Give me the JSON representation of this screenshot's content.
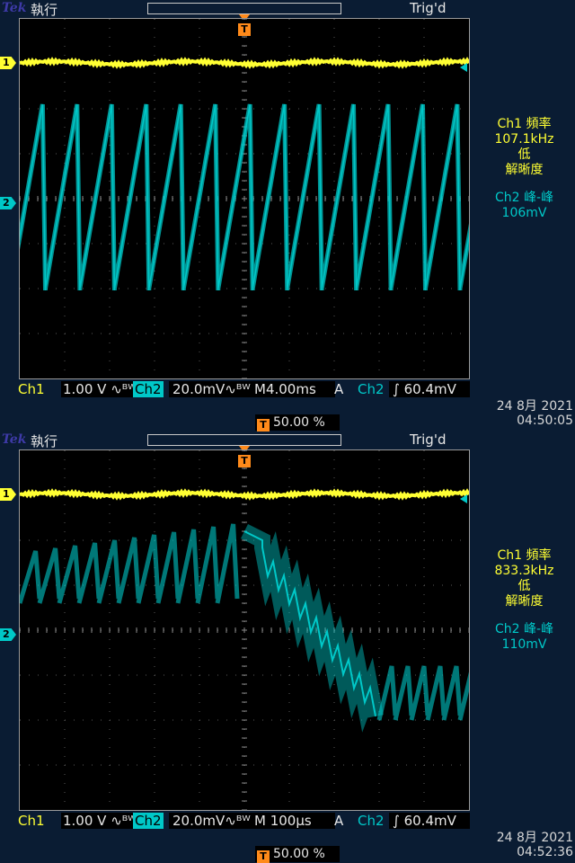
{
  "colors": {
    "ch1": "#ffff33",
    "ch2": "#00c8c8",
    "trigger": "#ff8a1a",
    "panel": "#0a1c33"
  },
  "screens": [
    {
      "brand": "Tek",
      "run_state": "執行",
      "trig_status": "Trig'd",
      "ch1_marker": "1",
      "ch2_marker": "2",
      "trig_marker": "T",
      "readouts": {
        "ch1_label": "Ch1 頻率",
        "ch1_value": "107.1kHz",
        "ch1_note1": "低",
        "ch1_note2": "解晰度",
        "ch2_label": "Ch2 峰-峰",
        "ch2_value": "106mV"
      },
      "status": {
        "ch1_label": "Ch1",
        "ch1_scale": "1.00 V ∿ᴮᵂ",
        "ch2_label": "Ch2",
        "ch2_scale": "20.0mV∿ᴮᵂ",
        "timebase": "M4.00ms",
        "trig_mode": "A",
        "trig_source": "Ch2",
        "trig_level": "∫ 60.4mV"
      },
      "date": "24 8月  2021",
      "time": "04:50:05",
      "trig_position": "50.00 %",
      "waveform": {
        "ch2_shape": "sawtooth",
        "ch2_cycles": 13
      }
    },
    {
      "brand": "Tek",
      "run_state": "執行",
      "trig_status": "Trig'd",
      "ch1_marker": "1",
      "ch2_marker": "2",
      "trig_marker": "T",
      "readouts": {
        "ch1_label": "Ch1 頻率",
        "ch1_value": "833.3kHz",
        "ch1_note1": "低",
        "ch1_note2": "解晰度",
        "ch2_label": "Ch2 峰-峰",
        "ch2_value": "110mV"
      },
      "status": {
        "ch1_label": "Ch1",
        "ch1_scale": "1.00 V ∿ᴮᵂ",
        "ch2_label": "Ch2",
        "ch2_scale": "20.0mV∿ᴮᵂ",
        "timebase": "M 100µs",
        "trig_mode": "A",
        "trig_source": "Ch2",
        "trig_level": "∫ 60.4mV"
      },
      "date": "24 8月  2021",
      "time": "04:52:36",
      "trig_position": "50.00 %",
      "waveform": {
        "ch2_shape": "sawtooth-with-ramp-down",
        "ch2_cycles": 11
      }
    }
  ]
}
